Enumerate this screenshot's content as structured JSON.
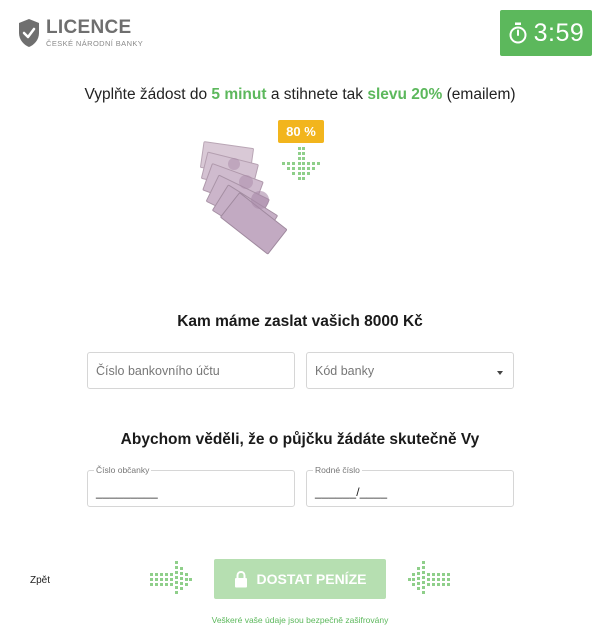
{
  "logo": {
    "title": "LICENCE",
    "subtitle": "ČESKÉ NÁRODNÍ BANKY",
    "icon": "shield-check-icon"
  },
  "timer": {
    "text": "3:59",
    "icon": "stopwatch-icon",
    "color": "#5cb85c"
  },
  "promo": {
    "part1": "Vyplňte žádost do ",
    "highlight1": "5 minut",
    "part2": " a stihnete tak ",
    "highlight2": "slevu 20%",
    "part3": " (emailem)",
    "accent": "#5cb85c"
  },
  "banner": {
    "badge": "80 %",
    "badge_color": "#f2b51d",
    "image": "banknotes-fan"
  },
  "section1": {
    "heading": "Kam máme zaslat vašich 8000 Kč",
    "account_placeholder": "Číslo bankovního účtu",
    "bank_code_placeholder": "Kód banky"
  },
  "section2": {
    "heading": "Abychom věděli, že o půjčku žádáte skutečně Vy",
    "id_label": "Číslo občanky",
    "id_value": "_________",
    "birth_label": "Rodné číslo",
    "birth_value": "______/____"
  },
  "footer": {
    "back": "Zpět",
    "submit": "DOSTAT PENÍZE",
    "submit_color": "#b6dfb1",
    "secure_note": "Veškeré vaše údaje jsou bezpečně zašifrovány"
  }
}
